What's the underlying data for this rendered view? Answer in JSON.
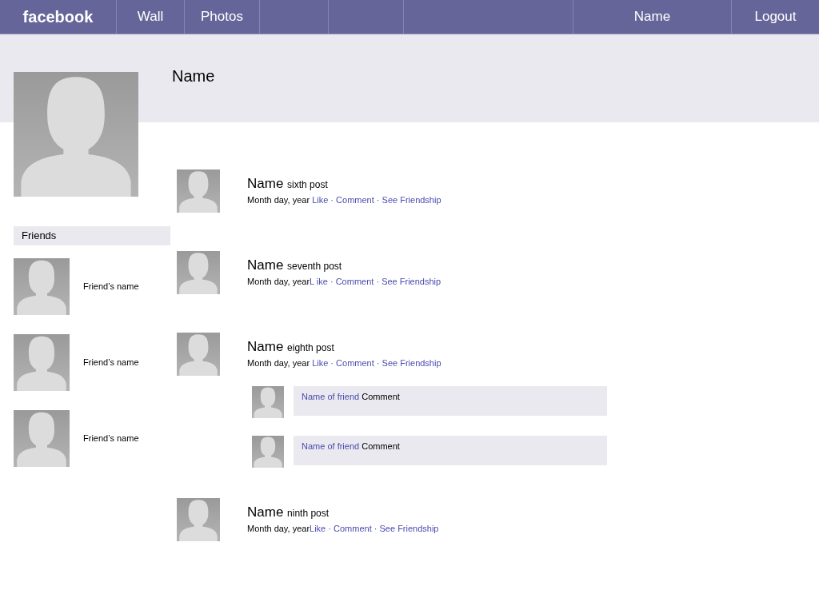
{
  "nav": {
    "logo": "facebook",
    "cells": [
      {
        "kind": "link",
        "label": "Wall"
      },
      {
        "kind": "link",
        "label": "Photos"
      },
      {
        "kind": "blank"
      },
      {
        "kind": "blank"
      },
      {
        "kind": "blank"
      },
      {
        "kind": "link",
        "label": "Name"
      },
      {
        "kind": "link",
        "label": "Logout"
      }
    ]
  },
  "profile": {
    "name": "Name"
  },
  "friends": {
    "title": "Friends",
    "items": [
      "Friend’s name",
      "Friend’s name",
      "Friend’s name"
    ]
  },
  "posts": [
    {
      "author": "Name",
      "text": "sixth post",
      "date": "Month day, year",
      "space_after_date": true,
      "links": [
        "Like",
        "Comment",
        "See Friendship"
      ],
      "separator": "·"
    },
    {
      "author": "Name",
      "text": "seventh post",
      "date": "Month day, year",
      "space_after_date": false,
      "links": [
        "L ike",
        "Comment",
        "See Friendship"
      ],
      "separator": "·"
    },
    {
      "author": "Name",
      "text": "eighth post",
      "date": "Month day, year",
      "space_after_date": true,
      "links": [
        "Like",
        "Comment",
        "See Friendship"
      ],
      "separator": "·",
      "comments": [
        {
          "author": "Name of friend",
          "text": "Comment"
        },
        {
          "author": "Name of friend",
          "text": "Comment"
        }
      ]
    },
    {
      "author": "Name",
      "text": "ninth post",
      "date": "Month day, year",
      "space_after_date": false,
      "links": [
        "Like",
        "Comment",
        "See Friendship"
      ],
      "separator": "·"
    }
  ]
}
